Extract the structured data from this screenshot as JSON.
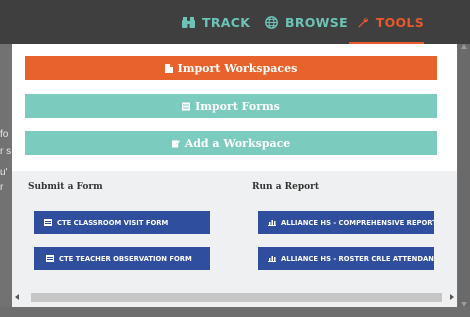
{
  "nav": {
    "track_label": "TRACK",
    "browse_label": "BROWSE",
    "tools_label": "TOOLS",
    "active": "TOOLS"
  },
  "colors": {
    "nav_bg": "#3f3f3f",
    "nav_link": "#6cc3b6",
    "nav_active": "#e8582a",
    "orange_button": "#e8632b",
    "teal_button": "#7ccbbf",
    "blue_button": "#2f4f9e"
  },
  "underlying_page": {
    "fragments": [
      "fo",
      "r s",
      "u'",
      "r"
    ]
  },
  "tools_menu": {
    "actions": [
      {
        "label": "Import Workspaces",
        "icon": "document-icon"
      },
      {
        "label": "Import Forms",
        "icon": "form-icon"
      },
      {
        "label": "Add a Workspace",
        "icon": "edit-icon"
      }
    ],
    "submit_form": {
      "title": "Submit a Form",
      "items": [
        {
          "label": "CTE CLASSROOM VISIT FORM",
          "icon": "form-icon"
        },
        {
          "label": "CTE TEACHER OBSERVATION FORM",
          "icon": "form-icon"
        }
      ]
    },
    "run_report": {
      "title": "Run a Report",
      "items": [
        {
          "label": "ALLIANCE HS - COMPREHENSIVE REPORT",
          "icon": "bar-chart-icon"
        },
        {
          "label": "ALLIANCE HS - ROSTER CRLE ATTENDANCE REPORT",
          "icon": "bar-chart-icon"
        }
      ]
    }
  }
}
